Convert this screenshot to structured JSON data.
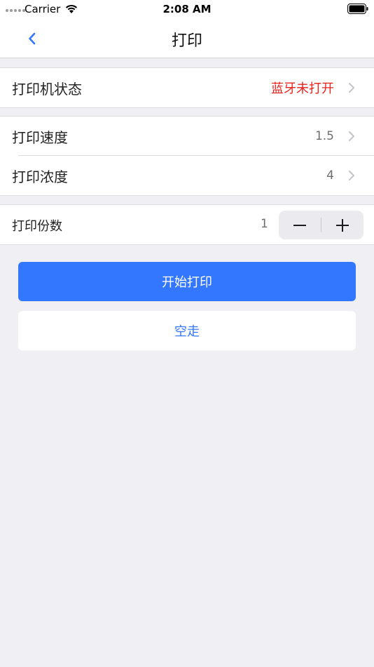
{
  "status_bar": {
    "carrier": "Carrier",
    "time": "2:08 AM",
    "icons": [
      "signal-dots-icon",
      "wifi-icon",
      "battery-icon"
    ]
  },
  "nav": {
    "title": "打印",
    "back_icon": "chevron-left-icon"
  },
  "printer_status": {
    "label": "打印机状态",
    "value": "蓝牙未打开",
    "value_color": "#e8231d"
  },
  "settings": {
    "speed": {
      "label": "打印速度",
      "value": "1.5"
    },
    "density": {
      "label": "打印浓度",
      "value": "4"
    }
  },
  "copies": {
    "label": "打印份数",
    "value": "1",
    "decrement_icon": "minus-icon",
    "increment_icon": "plus-icon"
  },
  "actions": {
    "start_print": "开始打印",
    "feed": "空走"
  },
  "colors": {
    "accent": "#3377ff",
    "background": "#efeff4",
    "warning": "#e8231d"
  }
}
